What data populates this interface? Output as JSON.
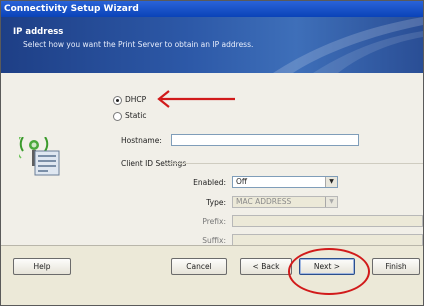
{
  "window": {
    "title": "Connectivity Setup Wizard"
  },
  "header": {
    "title": "IP address",
    "subtitle": "Select how you want the Print Server to obtain an IP address."
  },
  "ip_mode": {
    "options": [
      {
        "label": "DHCP",
        "selected": true
      },
      {
        "label": "Static",
        "selected": false
      }
    ]
  },
  "hostname": {
    "label": "Hostname:",
    "value": ""
  },
  "client_id": {
    "group_label": "Client ID Settings",
    "enabled": {
      "label": "Enabled:",
      "value": "Off"
    },
    "type": {
      "label": "Type:",
      "value": "MAC ADDRESS"
    },
    "prefix": {
      "label": "Prefix:",
      "value": ""
    },
    "suffix": {
      "label": "Suffix:",
      "value": ""
    }
  },
  "buttons": {
    "help": "Help",
    "cancel": "Cancel",
    "back": "< Back",
    "next": "Next >",
    "finish": "Finish"
  },
  "colors": {
    "annotation": "#d11a1a",
    "titlebar": "#0a43b8",
    "banner": "#2d59a8"
  },
  "icons": [
    "network-wireless-icon",
    "dropdown-arrow-icon"
  ]
}
